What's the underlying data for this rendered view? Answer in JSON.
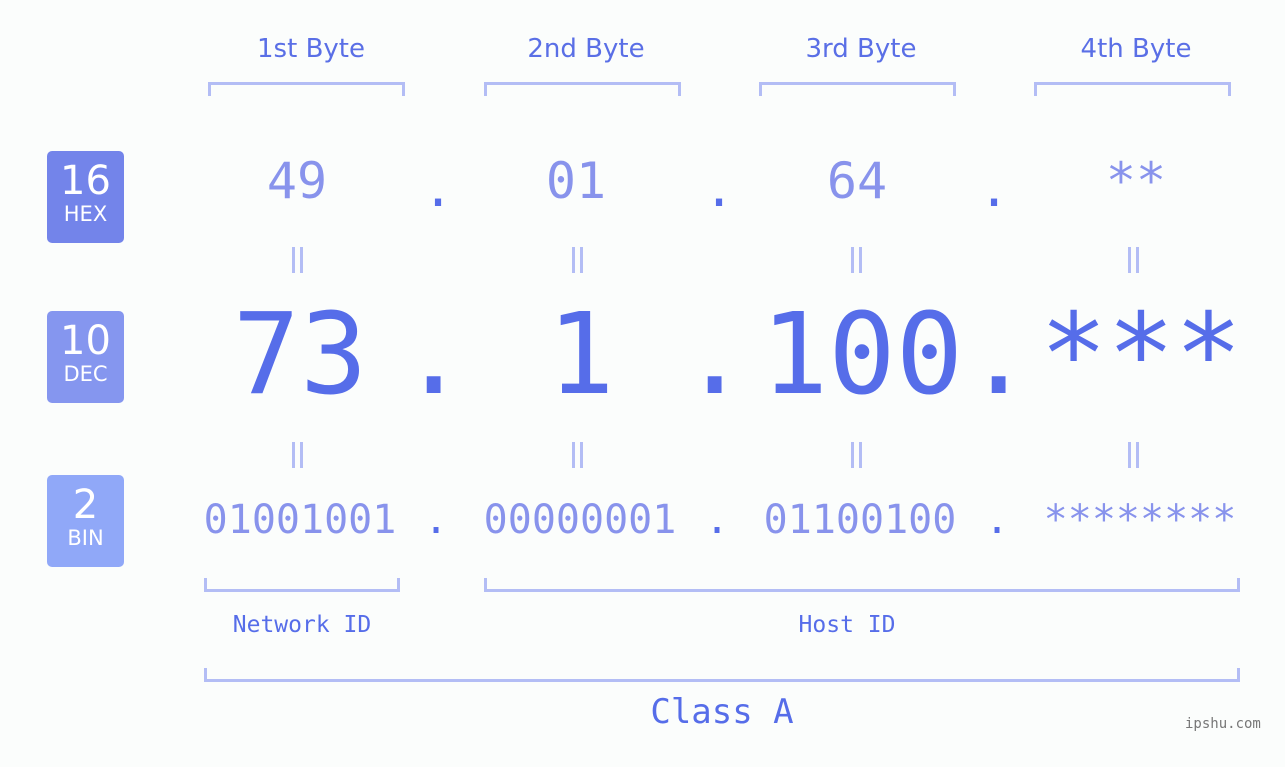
{
  "badges": [
    {
      "num": "16",
      "label": "HEX",
      "color": "#7384ea"
    },
    {
      "num": "10",
      "label": "DEC",
      "color": "#8596ef"
    },
    {
      "num": "2",
      "label": "BIN",
      "color": "#90a8f8"
    }
  ],
  "headers": [
    "1st Byte",
    "2nd Byte",
    "3rd Byte",
    "4th Byte"
  ],
  "hex": [
    "49",
    "01",
    "64",
    "**"
  ],
  "dec": [
    "73",
    "1",
    "100",
    "***"
  ],
  "bin": [
    "01001001",
    "00000001",
    "01100100",
    "********"
  ],
  "separator": ".",
  "network_label": "Network ID",
  "host_label": "Host ID",
  "class_label": "Class A",
  "watermark": "ipshu.com",
  "colors": {
    "accent": "#566de9",
    "light": "#8893ec",
    "bracket": "#b3bdf5"
  }
}
